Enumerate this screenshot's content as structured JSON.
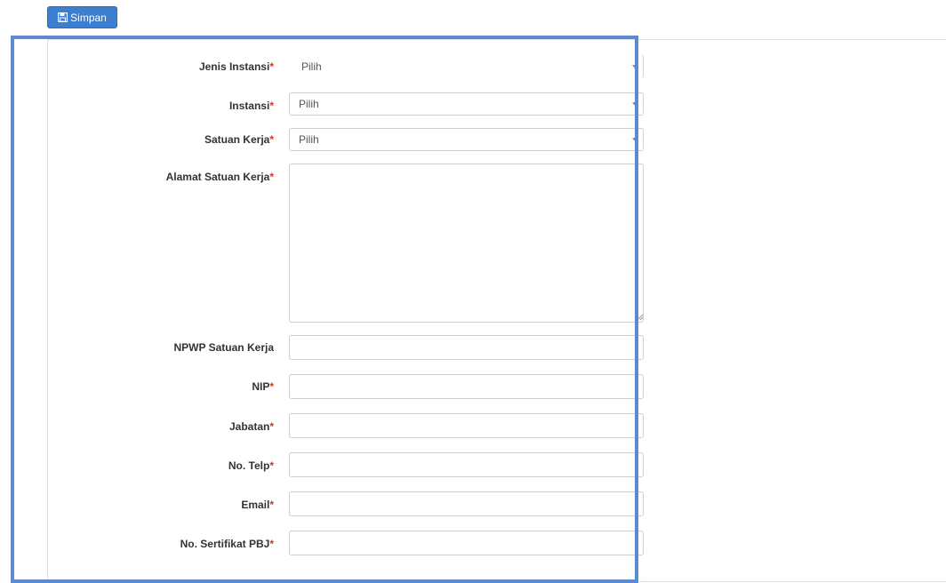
{
  "toolbar": {
    "save_label": "Simpan",
    "save_icon": "floppy-disk-icon"
  },
  "form": {
    "required_mark": "*",
    "fields": {
      "jenis_instansi": {
        "label": "Jenis Instansi",
        "value": "Pilih"
      },
      "instansi": {
        "label": "Instansi",
        "value": "Pilih"
      },
      "satuan_kerja": {
        "label": "Satuan Kerja",
        "value": "Pilih"
      },
      "alamat_satuan_kerja": {
        "label": "Alamat Satuan Kerja",
        "value": ""
      },
      "npwp_satuan_kerja": {
        "label": "NPWP Satuan Kerja",
        "value": ""
      },
      "nip": {
        "label": "NIP",
        "value": ""
      },
      "jabatan": {
        "label": "Jabatan",
        "value": ""
      },
      "no_telp": {
        "label": "No. Telp",
        "value": ""
      },
      "email": {
        "label": "Email",
        "value": ""
      },
      "no_sertifikat_pbj": {
        "label": "No. Sertifikat PBJ",
        "value": ""
      }
    }
  },
  "colors": {
    "primary": "#3c7fd0",
    "required": "#c0392b",
    "highlight": "#5b8ad1"
  }
}
